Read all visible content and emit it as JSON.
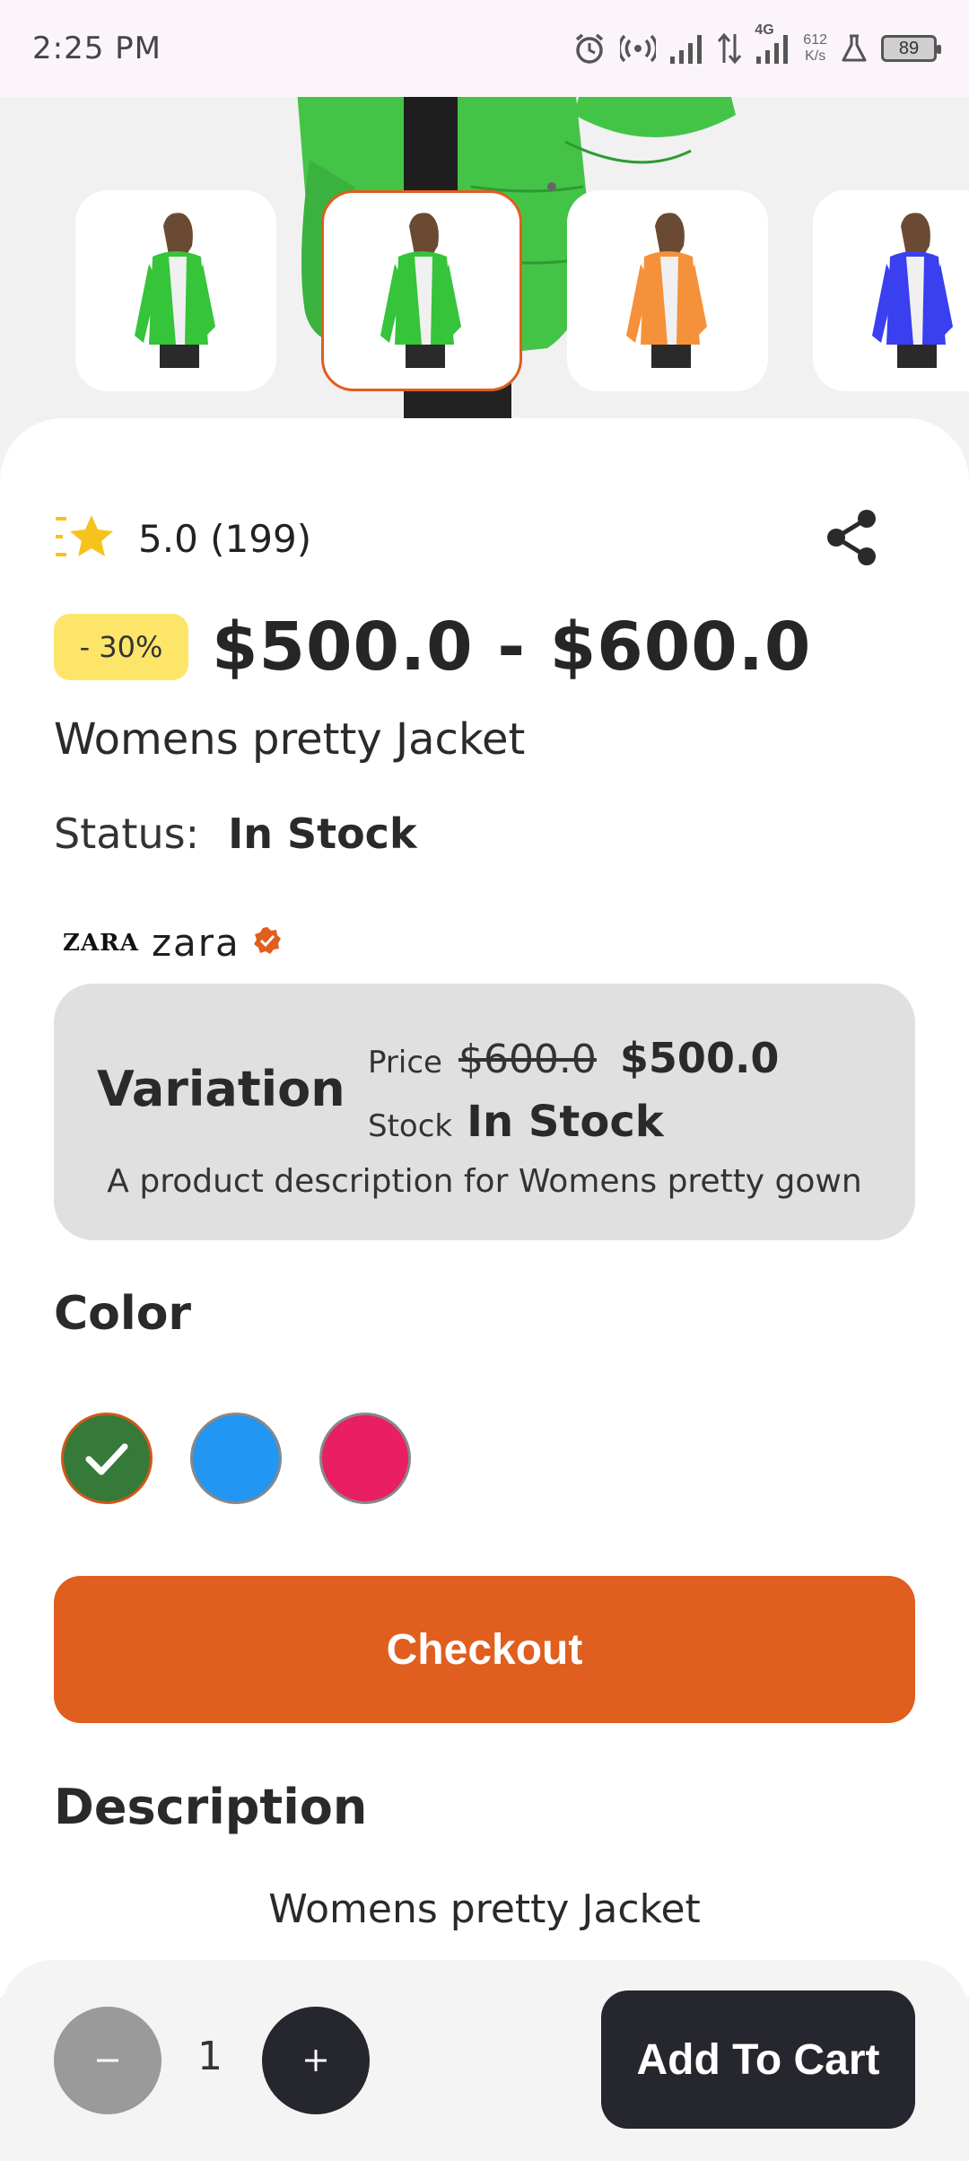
{
  "status_bar": {
    "time": "2:25 PM",
    "net_speed_value": "612",
    "net_speed_unit": "K/s",
    "network": "4G",
    "battery": "89",
    "icons": [
      "alarm-icon",
      "hotspot-icon",
      "signal-icon",
      "data-transfer-icon",
      "signal-4g-icon",
      "flask-icon",
      "battery-icon"
    ]
  },
  "gallery": {
    "thumbnails": [
      {
        "color_name": "green",
        "color": "#35c43a"
      },
      {
        "color_name": "green",
        "color": "#35c43a",
        "selected": true
      },
      {
        "color_name": "orange",
        "color": "#f5913a"
      },
      {
        "color_name": "blue",
        "color": "#3a3ff0"
      }
    ]
  },
  "product": {
    "rating": "5.0 (199)",
    "discount": "- 30%",
    "price_range": "$500.0 - $600.0",
    "title": "Womens pretty Jacket",
    "status_label": "Status:",
    "status_value": "In Stock",
    "brand_logo": "ZARA",
    "brand_name": "zara"
  },
  "variation": {
    "title": "Variation",
    "price_label": "Price",
    "old_price": "$600.0",
    "new_price": "$500.0",
    "stock_label": "Stock",
    "stock_value": "In Stock",
    "description": "A product description for Womens pretty gown"
  },
  "colors": {
    "heading": "Color",
    "options": [
      {
        "hex": "#357a38",
        "selected": true
      },
      {
        "hex": "#2196f3",
        "selected": false
      },
      {
        "hex": "#e91e63",
        "selected": false
      }
    ]
  },
  "checkout_label": "Checkout",
  "description": {
    "heading": "Description",
    "text": "Womens pretty Jacket"
  },
  "bottom_bar": {
    "quantity": "1",
    "add_to_cart_label": "Add To Cart"
  },
  "theme": {
    "accent": "#e05e1e",
    "dark": "#26262e",
    "badge": "#fde56a",
    "star": "#f6c21c"
  }
}
